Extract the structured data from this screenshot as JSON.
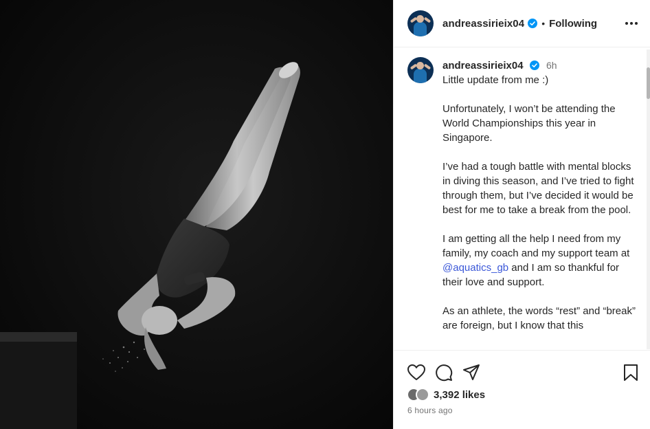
{
  "header": {
    "username": "andreassirieix04",
    "separator": "•",
    "follow_status": "Following"
  },
  "caption": {
    "username": "andreassirieix04",
    "time": "6h",
    "paragraphs": [
      "Little update from me :)",
      "Unfortunately, I won’t be attending the World Championships this year in Singapore.",
      "I’ve had a tough battle with mental blocks in diving this season, and I’ve tried to fight through them, but I’ve decided it would be best for me to take a break from the pool."
    ],
    "para4_before": "I am getting all the help I need from my family, my coach and my support team at ",
    "para4_mention": "@aquatics_gb",
    "para4_after": " and I am so thankful for their love and support.",
    "para5": "As an athlete, the words “rest” and “break” are foreign, but I know that this"
  },
  "footer": {
    "likes": "3,392 likes",
    "posted": "6 hours ago"
  },
  "colors": {
    "verified": "#0095f6",
    "mention": "#3a57d8",
    "photo_bg": "#090909"
  },
  "icons": [
    "verified-icon",
    "more-options-icon",
    "heart-icon",
    "comment-icon",
    "share-icon",
    "bookmark-icon"
  ]
}
